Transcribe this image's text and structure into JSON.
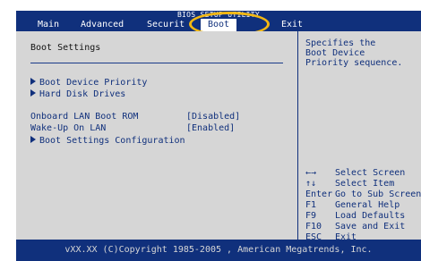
{
  "title": "BIOS SETUP UTILITY",
  "menu": {
    "items": [
      {
        "label": "Main",
        "active": false
      },
      {
        "label": "Advanced",
        "active": false
      },
      {
        "label": "Securit",
        "active": false
      },
      {
        "label": "Boot",
        "active": true
      },
      {
        "label": "Exit",
        "active": false
      }
    ]
  },
  "panel": {
    "title": "Boot Settings",
    "rows": [
      {
        "label": "Boot Device Priority",
        "submenu": true
      },
      {
        "label": "Hard Disk Drives",
        "submenu": true
      },
      {
        "label": "Onboard LAN Boot ROM",
        "value": "[Disabled]"
      },
      {
        "label": "Wake-Up On LAN",
        "value": "[Enabled]"
      },
      {
        "label": "Boot Settings Configuration",
        "submenu": true
      }
    ]
  },
  "help": {
    "lines": [
      "Specifies the",
      "Boot Device",
      "Priority sequence."
    ]
  },
  "keys": [
    {
      "key": "←→",
      "desc": "Select Screen"
    },
    {
      "key": "↑↓",
      "desc": "Select Item"
    },
    {
      "key": "Enter",
      "desc": "Go to Sub Screen"
    },
    {
      "key": "F1",
      "desc": "General Help"
    },
    {
      "key": "F9",
      "desc": "Load Defaults"
    },
    {
      "key": "F10",
      "desc": "Save and Exit"
    },
    {
      "key": "ESC",
      "desc": "Exit"
    }
  ],
  "footer": "vXX.XX (C)Copyright 1985-2005 , American Megatrends, Inc.",
  "colors": {
    "accent": "#10307c",
    "panel": "#d6d6d6",
    "highlight_ring": "#f2b713"
  }
}
